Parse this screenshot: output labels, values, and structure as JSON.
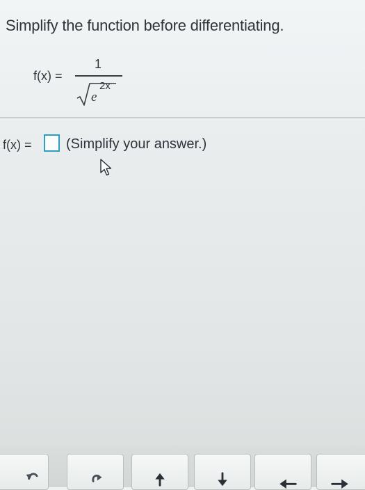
{
  "question": {
    "instruction": "Simplify the function before differentiating.",
    "given_lhs": "f(x) =",
    "numerator": "1",
    "base": "e",
    "exponent": "2x"
  },
  "answer": {
    "lhs": "f(x) =",
    "value": "",
    "hint": "(Simplify your answer.)"
  },
  "toolbar": {
    "buttons": [
      "undo-icon",
      "redo-icon",
      "arrow-up-icon",
      "arrow-down-icon",
      "arrow-left-icon",
      "arrow-right-icon"
    ]
  },
  "colors": {
    "answer_box_border": "#2b9fc0",
    "text": "#2b2f36"
  }
}
